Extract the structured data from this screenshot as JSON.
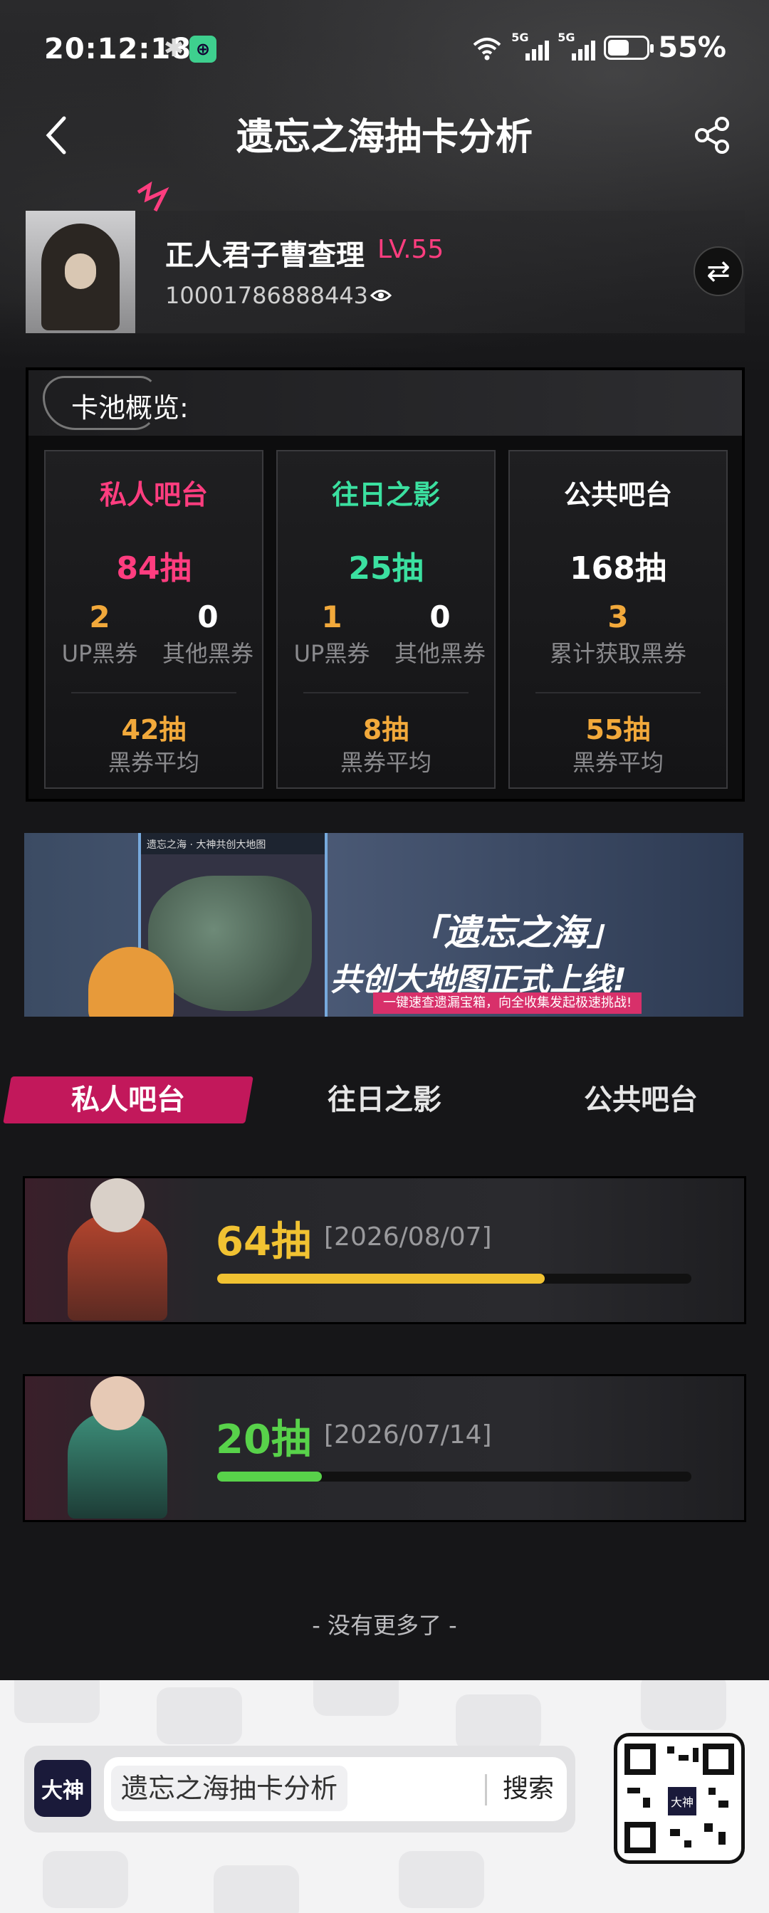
{
  "status_bar": {
    "time": "20:12:18",
    "bluetooth_icon": "bluetooth-icon",
    "app_badge": "⊕",
    "sig1_label": "5G",
    "sig2_label": "5G",
    "battery_pct": "55%",
    "battery_level": 0.55
  },
  "header": {
    "title": "遗忘之海抽卡分析",
    "back_icon": "chevron-left-icon",
    "share_icon": "share-icon"
  },
  "profile": {
    "name": "正人君子曹查理",
    "level": "LV.55",
    "id": "10001786888443",
    "switch_icon": "⇄"
  },
  "pool_overview": {
    "title": "卡池概览:",
    "cards": [
      {
        "title": "私人吧台",
        "total": "84抽",
        "a_num": "2",
        "a_label": "UP黑券",
        "b_num": "0",
        "b_label": "其他黑券",
        "avg": "42抽",
        "avg_label": "黑券平均",
        "color": "#ff3d7f"
      },
      {
        "title": "往日之影",
        "total": "25抽",
        "a_num": "1",
        "a_label": "UP黑券",
        "b_num": "0",
        "b_label": "其他黑券",
        "avg": "8抽",
        "avg_label": "黑券平均",
        "color": "#3be0a0"
      },
      {
        "title": "公共吧台",
        "total": "168抽",
        "single_num": "3",
        "single_label": "累计获取黑券",
        "avg": "55抽",
        "avg_label": "黑券平均",
        "color": "#ffffff"
      }
    ]
  },
  "banner": {
    "map_title": "遗忘之海 · 大神共创大地图",
    "line1": "「遗忘之海」",
    "line2": "共创大地图正式上线!",
    "line3": "一键速查遗漏宝箱，向全收集发起极速挑战!"
  },
  "tabs": [
    {
      "label": "私人吧台",
      "active": true
    },
    {
      "label": "往日之影",
      "active": false
    },
    {
      "label": "公共吧台",
      "active": false
    }
  ],
  "records": [
    {
      "count": "64抽",
      "date": "[2026/08/07]",
      "progress": 0.69,
      "color": "#f1c232"
    },
    {
      "count": "20抽",
      "date": "[2026/07/14]",
      "progress": 0.22,
      "color": "#58d24a"
    }
  ],
  "no_more": "- 没有更多了 -",
  "footer": {
    "logo": "大神",
    "query": "遗忘之海抽卡分析",
    "search_btn": "搜索",
    "qr_center": "大神"
  }
}
